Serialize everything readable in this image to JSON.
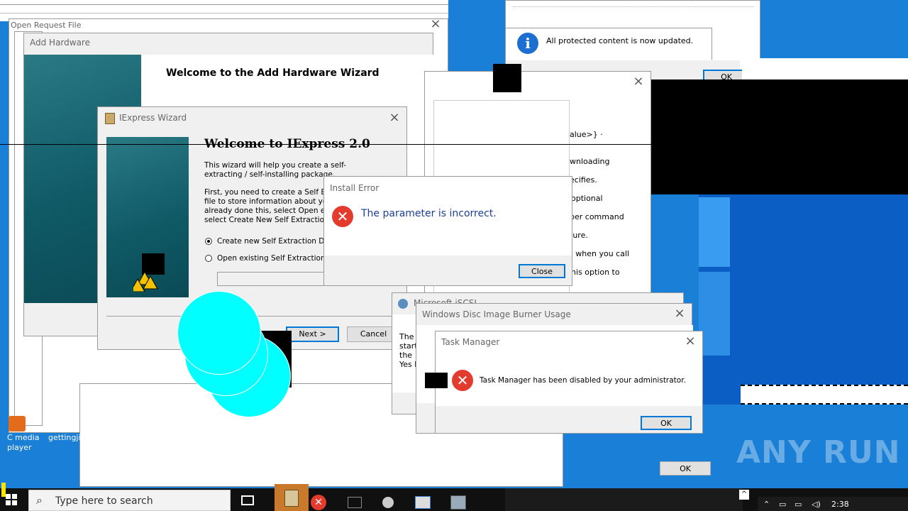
{
  "windows": {
    "open_request": {
      "title": "Open Request File"
    },
    "add_hardware": {
      "title": "Add Hardware",
      "heading": "Welcome to the Add Hardware Wizard"
    },
    "iexpress": {
      "title": "IExpress Wizard",
      "heading": "Welcome to IExpress 2.0",
      "para1": "This wizard will help you create a self-extracting / self-installing package.",
      "para2_lines": [
        "First, you need to create a Self Extra",
        "file to store information about your pa",
        "already done this, select Open existi",
        "select Create New Self Extraction D"
      ],
      "radio_create": "Create new Self Extraction Direc",
      "radio_open": "Open existing Self Extraction Dir",
      "next_button": "Next >",
      "cancel_button": "Cancel"
    },
    "install_error": {
      "title": "Install Error",
      "message": "The parameter is incorrect.",
      "close_button": "Close"
    },
    "update_notice": {
      "message": "All protected content is now updated.",
      "ok_button": "OK"
    },
    "background_help": {
      "fragments": [
        "alue>} ·",
        "wnloading",
        "ecifies.",
        "optional",
        "per command",
        "ture.",
        "e when you call",
        "his option to"
      ]
    },
    "iscsi": {
      "title": "Microsoft iSCSI",
      "lines": [
        "The",
        "start",
        "the",
        "Yes b"
      ]
    },
    "disc_burner": {
      "title": "Windows Disc Image Burner Usage"
    },
    "task_manager": {
      "title": "Task Manager",
      "message": "Task Manager has been disabled by your administrator.",
      "ok_button": "OK"
    },
    "bottom_dialog": {
      "ok_button": "OK"
    }
  },
  "desktop": {
    "icon_media": "C media player",
    "icon_getting": "gettingji"
  },
  "taskbar": {
    "search_placeholder": "Type here to search",
    "clock": "2:38"
  },
  "watermark": "ANY RUN",
  "colors": {
    "desktop": "#1a7fd6",
    "error": "#e33b2e",
    "info": "#1c6fd1",
    "cyan": "#00ffff"
  }
}
